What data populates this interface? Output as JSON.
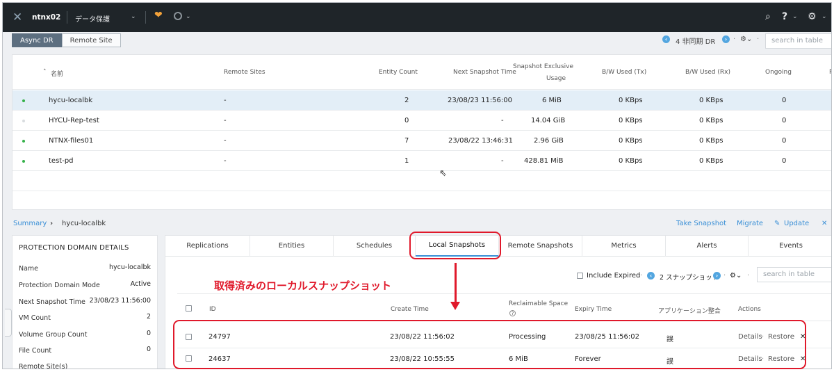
{
  "topbar": {
    "cluster": "ntnx02",
    "section": "データ保護",
    "search_icon": "search-icon",
    "help_icon": "?",
    "settings_icon": "gear-icon"
  },
  "view_tabs": [
    "Async DR",
    "Remote Site"
  ],
  "toolbar": {
    "count_label": "4 非同期 DR",
    "search_placeholder": "search in table"
  },
  "main_table": {
    "columns": [
      "名前",
      "Remote Sites",
      "Entity Count",
      "Next Snapshot Time",
      "Snapshot Exclusive",
      "Usage",
      "B/W Used (Tx)",
      "B/W Used (Rx)",
      "Ongoing",
      "P"
    ],
    "rows": [
      {
        "name": "hycu-localbk",
        "remote": "-",
        "entity": "2",
        "next": "23/08/23 11:56:00",
        "usage": "6 MiB",
        "tx": "0 KBps",
        "rx": "0 KBps",
        "ongoing": "0",
        "active": true
      },
      {
        "name": "HYCU-Rep-test",
        "remote": "-",
        "entity": "0",
        "next": "-",
        "usage": "14.04 GiB",
        "tx": "0 KBps",
        "rx": "0 KBps",
        "ongoing": "0",
        "active": false
      },
      {
        "name": "NTNX-files01",
        "remote": "-",
        "entity": "7",
        "next": "23/08/22 13:46:31",
        "usage": "2.96 GiB",
        "tx": "0 KBps",
        "rx": "0 KBps",
        "ongoing": "0",
        "active": true
      },
      {
        "name": "test-pd",
        "remote": "-",
        "entity": "1",
        "next": "-",
        "usage": "428.81 MiB",
        "tx": "0 KBps",
        "rx": "0 KBps",
        "ongoing": "0",
        "active": true
      }
    ]
  },
  "breadcrumb": {
    "root": "Summary",
    "current": "hycu-localbk"
  },
  "actions": [
    "Take Snapshot",
    "Migrate",
    "Update"
  ],
  "details": {
    "title": "PROTECTION DOMAIN DETAILS",
    "items": [
      {
        "label": "Name",
        "value": "hycu-localbk"
      },
      {
        "label": "Protection Domain Mode",
        "value": "Active"
      },
      {
        "label": "Next Snapshot Time",
        "value": "23/08/23 11:56:00"
      },
      {
        "label": "VM Count",
        "value": "2"
      },
      {
        "label": "Volume Group Count",
        "value": "0"
      },
      {
        "label": "File Count",
        "value": "0"
      },
      {
        "label": "Remote Site(s)",
        "value": ""
      }
    ]
  },
  "detail_tabs": [
    "Replications",
    "Entities",
    "Schedules",
    "Local Snapshots",
    "Remote Snapshots",
    "Metrics",
    "Alerts",
    "Events"
  ],
  "snapshot_toolbar": {
    "include_expired": "Include Expired",
    "count_label": "2 スナップショット",
    "search_placeholder": "search in table"
  },
  "annotation": "取得済みのローカルスナップショット",
  "snapshot_table": {
    "columns": [
      "ID",
      "Create Time",
      "Reclaimable Space",
      "Expiry Time",
      "アプリケーション整合",
      "Actions"
    ],
    "rows": [
      {
        "id": "24797",
        "create": "23/08/22 11:56:02",
        "space": "Processing",
        "expiry": "23/08/25 11:56:02",
        "app": "誤",
        "details": "Details",
        "restore": "Restore"
      },
      {
        "id": "24637",
        "create": "23/08/22 10:55:55",
        "space": "6 MiB",
        "expiry": "Forever",
        "app": "誤",
        "details": "Details",
        "restore": "Restore"
      }
    ]
  },
  "colors": {
    "topbar": "#1f2529",
    "accent": "#3a8fd6",
    "highlight": "#e0192b",
    "active_dot": "#35b14a"
  }
}
